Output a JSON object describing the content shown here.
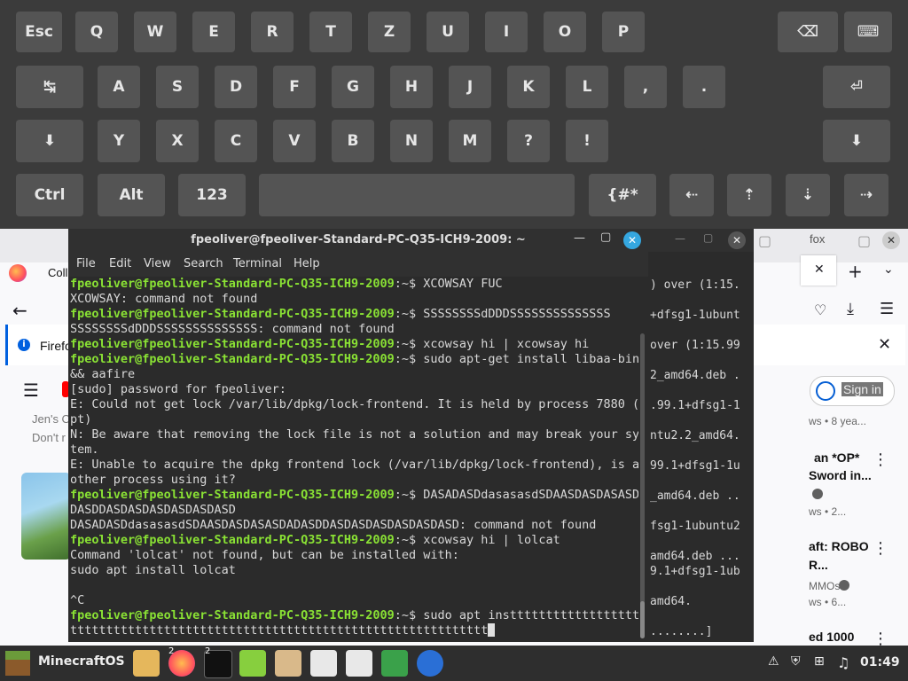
{
  "keyboard": {
    "row1": [
      "Esc",
      "Q",
      "W",
      "E",
      "R",
      "T",
      "Z",
      "U",
      "I",
      "O",
      "P"
    ],
    "row2": [
      "A",
      "S",
      "D",
      "F",
      "G",
      "H",
      "J",
      "K",
      "L",
      ",",
      "."
    ],
    "row3": [
      "Y",
      "X",
      "C",
      "V",
      "B",
      "N",
      "M",
      "?",
      "!"
    ],
    "row4": {
      "ctrl": "Ctrl",
      "alt": "Alt",
      "num": "123",
      "sym": "{#*"
    },
    "icons": {
      "backspace": "⌫",
      "hide_keyboard": "⌨",
      "tab": "↹",
      "enter": "⏎",
      "shift_left": "⬇",
      "shift_right": "⬇",
      "left": "⇠",
      "up": "⇡",
      "down": "⇣",
      "right": "⇢"
    }
  },
  "firefox": {
    "tab_label": "Coll",
    "tab2_label": "fox",
    "notice": "Firefo",
    "signin": "Sign in",
    "left_text1": "Jen's C",
    "left_text2": "Don't r",
    "right_items": [
      {
        "t1": "ws",
        "t2": "• 8 yea..."
      },
      {
        "t1": "an *OP*",
        "t2": "Sword in..."
      },
      {
        "t1": "ws",
        "t2": "• 2..."
      },
      {
        "t1": "aft: ROBO",
        "t2": "R..."
      },
      {
        "t1": "MMOs",
        "t2": "ws • 6..."
      },
      {
        "t1": "ed 1000",
        "t2": ""
      }
    ]
  },
  "terminal": {
    "title": "fpeoliver@fpeoliver-Standard-PC-Q35-ICH9-2009: ~",
    "menu": [
      "File",
      "Edit",
      "View",
      "Search",
      "Terminal",
      "Help"
    ],
    "prompt": "fpeoliver@fpeoliver-Standard-PC-Q35-ICH9-2009",
    "lines": [
      {
        "p": true,
        "t": "~$ XCOWSAY FUC"
      },
      {
        "p": false,
        "t": "XCOWSAY: command not found"
      },
      {
        "p": true,
        "t": "~$ SSSSSSSSdDDDSSSSSSSSSSSSSS"
      },
      {
        "p": false,
        "t": "SSSSSSSSdDDDSSSSSSSSSSSSSS: command not found"
      },
      {
        "p": true,
        "t": "~$ xcowsay hi | xcowsay hi"
      },
      {
        "p": true,
        "t": "~$ sudo apt-get install libaa-bin"
      },
      {
        "p": false,
        "t": "&& aafire"
      },
      {
        "p": false,
        "t": "[sudo] password for fpeoliver:"
      },
      {
        "p": false,
        "t": "E: Could not get lock /var/lib/dpkg/lock-frontend. It is held by process 7880 (a"
      },
      {
        "p": false,
        "t": "pt)"
      },
      {
        "p": false,
        "t": "N: Be aware that removing the lock file is not a solution and may break your sys"
      },
      {
        "p": false,
        "t": "tem."
      },
      {
        "p": false,
        "t": "E: Unable to acquire the dpkg frontend lock (/var/lib/dpkg/lock-frontend), is an"
      },
      {
        "p": false,
        "t": "other process using it?"
      },
      {
        "p": true,
        "t": "~$ DASADASDdasasasdSDAASDASDASASDA"
      },
      {
        "p": false,
        "t": "DASDDASDASDASDASDASDASD"
      },
      {
        "p": false,
        "t": "DASADASDdasasasdSDAASDASDASASDADASDDASDASDASDASDASDASD: command not found"
      },
      {
        "p": true,
        "t": "~$ xcowsay hi | lolcat"
      },
      {
        "p": false,
        "t": "Command 'lolcat' not found, but can be installed with:"
      },
      {
        "p": false,
        "t": "sudo apt install lolcat"
      },
      {
        "p": false,
        "t": ""
      },
      {
        "p": false,
        "t": "^C"
      },
      {
        "p": true,
        "t": "~$ sudo apt insttttttttttttttttttt"
      },
      {
        "p": false,
        "t": "tttttttttttttttttttttttttttttttttttttttttttttttttttttttttt",
        "cursor": true
      }
    ]
  },
  "terminal2": {
    "lines": [
      ") over (1:15.",
      "",
      "+dfsg1-1ubunt",
      "",
      "over (1:15.99",
      "",
      "2_amd64.deb .",
      "",
      "",
      ".99.1+dfsg1-1",
      "",
      "ntu2.2_amd64.",
      "",
      "99.1+dfsg1-1u",
      "",
      "_amd64.deb ..",
      "",
      "fsg1-1ubuntu2",
      "",
      "amd64.deb ...",
      "9.1+dfsg1-1ub",
      "",
      "amd64.",
      "",
      "........]"
    ]
  },
  "taskbar": {
    "start_label": "MinecraftOS",
    "clock": "01:49",
    "badge1": "2",
    "badge2": "2"
  }
}
